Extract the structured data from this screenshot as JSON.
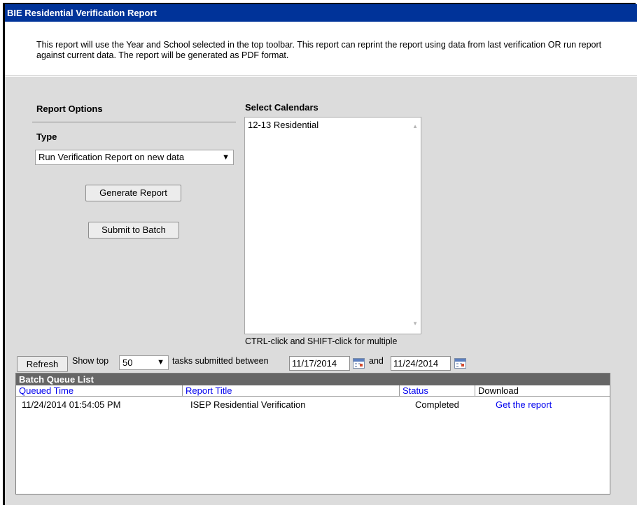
{
  "window": {
    "title": "BIE Residential Verification Report"
  },
  "description": "This report will use the Year and School selected in the top toolbar. This report can reprint the report using data from last verification OR run report against current data. The report will be generated as PDF format.",
  "options": {
    "heading": "Report Options",
    "type_label": "Type",
    "type_selected": "Run Verification Report on new data",
    "generate_label": "Generate Report",
    "batch_label": "Submit to Batch"
  },
  "calendars": {
    "heading": "Select Calendars",
    "items": [
      "12-13 Residential"
    ],
    "hint": "CTRL-click and SHIFT-click for multiple"
  },
  "queue_toolbar": {
    "refresh_label": "Refresh",
    "show_top_label": "Show top",
    "show_top_value": "50",
    "between_label": "tasks submitted between",
    "start_date": "11/17/2014",
    "and_label": "and",
    "end_date": "11/24/2014"
  },
  "batch_queue": {
    "title": "Batch Queue List",
    "columns": [
      "Queued Time",
      "Report Title",
      "Status",
      "Download"
    ],
    "rows": [
      {
        "queued_time": "11/24/2014 01:54:05 PM",
        "report_title": "ISEP Residential Verification",
        "status": "Completed",
        "download": "Get the report"
      }
    ]
  },
  "colors": {
    "title_bar": "#003399",
    "panel_bg": "#dcdcdc",
    "queue_header": "#666666",
    "link": "#0000ee"
  }
}
